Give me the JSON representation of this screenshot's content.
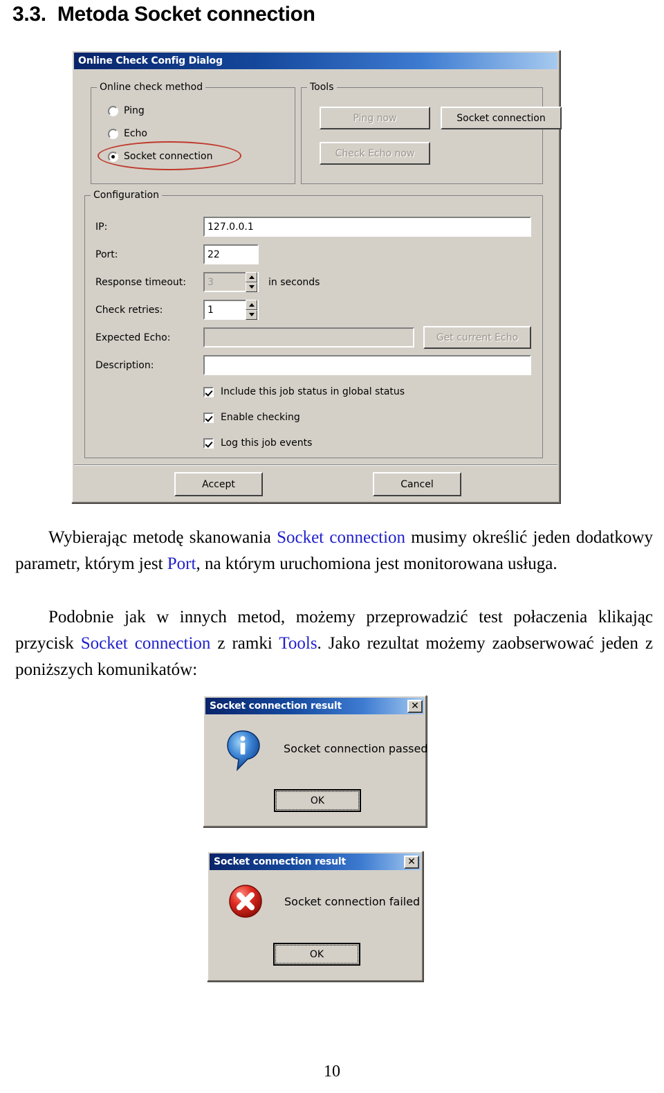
{
  "heading": {
    "number": "3.3.",
    "text": "Metoda Socket connection"
  },
  "config_dialog": {
    "title": "Online Check Config Dialog",
    "method_group": {
      "legend": "Online check method",
      "options": [
        {
          "label": "Ping",
          "selected": false
        },
        {
          "label": "Echo",
          "selected": false
        },
        {
          "label": "Socket connection",
          "selected": true
        }
      ],
      "highlight_color": "#c0392b"
    },
    "tools_group": {
      "legend": "Tools",
      "buttons": [
        {
          "label": "Ping now",
          "enabled": false
        },
        {
          "label": "Socket connection",
          "enabled": true
        },
        {
          "label": "Check Echo now",
          "enabled": false
        }
      ]
    },
    "configuration_group": {
      "legend": "Configuration",
      "fields": [
        {
          "label": "IP:",
          "value": "127.0.0.1",
          "enabled": true
        },
        {
          "label": "Port:",
          "value": "22",
          "enabled": true
        },
        {
          "label": "Response timeout:",
          "value": "3",
          "enabled": false,
          "suffix": "in seconds"
        },
        {
          "label": "Check retries:",
          "value": "1",
          "enabled": true
        },
        {
          "label": "Expected Echo:",
          "value": "",
          "enabled": false
        },
        {
          "label": "Description:",
          "value": "",
          "enabled": true
        }
      ],
      "echo_button": {
        "label": "Get current Echo",
        "enabled": false
      },
      "checkboxes": [
        {
          "label": "Include this job status in global status",
          "checked": true
        },
        {
          "label": "Enable checking",
          "checked": true
        },
        {
          "label": "Log this job events",
          "checked": true
        }
      ]
    },
    "accept_label": "Accept",
    "cancel_label": "Cancel"
  },
  "paragraph1": {
    "part1": "Wybierając metodę skanowania ",
    "kw1": "Socket connection",
    "part2": " musimy określić jeden dodatkowy parametr, którym jest ",
    "kw2": "Port",
    "part3": ", na którym uruchomiona jest monitorowana usługa."
  },
  "paragraph2": {
    "part1": "Podobnie jak w innych metod, możemy przeprowadzić test połaczenia klikając przycisk ",
    "kw1": "Socket connection",
    "part2": " z ramki ",
    "kw2": "Tools",
    "part3": ". Jako rezultat możemy zaobserwować jeden z poniższych komunikatów:"
  },
  "message_success": {
    "title": "Socket connection result",
    "close_label": "✕",
    "icon": "info-icon",
    "message": "Socket connection passed",
    "ok_label": "OK"
  },
  "message_failure": {
    "title": "Socket connection result",
    "close_label": "✕",
    "icon": "error-icon",
    "message": "Socket connection failed",
    "ok_label": "OK"
  },
  "page_number": "10"
}
